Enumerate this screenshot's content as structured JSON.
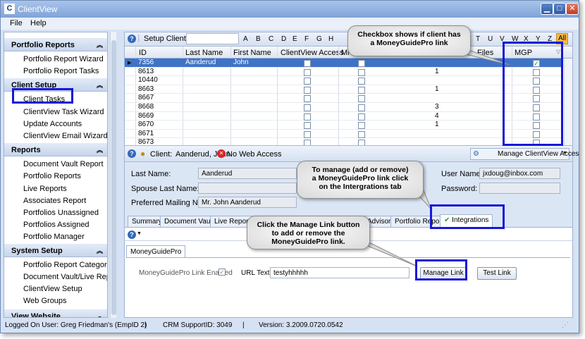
{
  "window": {
    "title": "ClientView"
  },
  "menu": [
    "File",
    "Help"
  ],
  "sidebar": {
    "sections": [
      {
        "title": "Portfolio Reports",
        "items": [
          "Portfolio Report Wizard",
          "Portfolio Report Tasks"
        ]
      },
      {
        "title": "Client Setup",
        "items": [
          "Client Tasks",
          "ClientView Task Wizard",
          "Update Accounts",
          "ClientView Email Wizard"
        ]
      },
      {
        "title": "Reports",
        "items": [
          "Document Vault Report",
          "Portfolio Reports",
          "Live Reports",
          "Associates Report",
          "Portfolios Unassigned",
          "Portfolios Assigned",
          "Portfolio Manager"
        ]
      },
      {
        "title": "System Setup",
        "items": [
          "Portfolio Report Categories..",
          "Document Vault/Live Report..",
          "ClientView Setup",
          "Web Groups"
        ]
      },
      {
        "title": "View Website",
        "items": []
      }
    ]
  },
  "toolbar": {
    "title": "Setup Client",
    "letters": [
      "A",
      "B",
      "C",
      "D",
      "E",
      "F",
      "G",
      "H",
      "T",
      "U",
      "V",
      "W",
      "X",
      "Y",
      "Z"
    ],
    "all_label": "All"
  },
  "grid": {
    "columns": [
      "ID",
      "Last Name",
      "First Name",
      "ClientView Access",
      "Mi",
      "Files",
      "MGP"
    ],
    "rows": [
      {
        "id": "7356",
        "last": "Aanderud",
        "first": "John",
        "files": "",
        "mgp": true
      },
      {
        "id": "8613",
        "last": "",
        "first": "",
        "files": "1",
        "mgp": false
      },
      {
        "id": "10440",
        "last": "",
        "first": "",
        "files": "",
        "mgp": false
      },
      {
        "id": "8663",
        "last": "",
        "first": "",
        "files": "1",
        "mgp": false
      },
      {
        "id": "8667",
        "last": "",
        "first": "",
        "files": "",
        "mgp": false
      },
      {
        "id": "8668",
        "last": "",
        "first": "",
        "files": "3",
        "mgp": false
      },
      {
        "id": "8669",
        "last": "",
        "first": "",
        "files": "4",
        "mgp": false
      },
      {
        "id": "8670",
        "last": "",
        "first": "",
        "files": "1",
        "mgp": false
      },
      {
        "id": "8671",
        "last": "",
        "first": "",
        "files": "",
        "mgp": false
      },
      {
        "id": "8673",
        "last": "",
        "first": "",
        "files": "",
        "mgp": false
      }
    ]
  },
  "infobar": {
    "client_label": "Client:",
    "client_name": "Aanderud, John",
    "web_access": "No Web Access",
    "manage_access": "Manage ClientView Access"
  },
  "details": {
    "last_name_label": "Last Name:",
    "last_name": "Aanderud",
    "spouse_label": "Spouse Last Name:",
    "spouse": "",
    "mailing_label": "Preferred Mailing Name:",
    "mailing": "Mr. John Aanderud",
    "user_label": "User Name:",
    "user": "jxdoug@inbox.com",
    "password_label": "Password:",
    "password": ""
  },
  "tabs": [
    "Summary",
    "Document Vault",
    "Live Reports",
    "Advisor",
    "Portfolio Reports",
    "Integrations"
  ],
  "integrations": {
    "subtab": "MoneyGuidePro",
    "link_enabled_label": "MoneyGuidePro Link Enabled",
    "url_label": "URL Text",
    "url_value": "testyhhhhh",
    "manage_button": "Manage Link",
    "test_button": "Test Link"
  },
  "status": {
    "user": "Logged On User: Greg Friedman's (EmpID 2)",
    "support": "CRM SupportID: 3049",
    "version": "Version: 3.2009.0720.0542"
  },
  "callouts": {
    "mgp": "Checkbox shows if client has\na MoneyGuidePro link",
    "integrations": "To manage (add or remove)\na MoneyGuidePro link click\non the Intergrations tab",
    "manage": "Click the Manage Link button\nto add or remove the\nMoneyGuidePro link."
  },
  "colors": {
    "selected_row": "#3f73c7",
    "highlight": "#1717d6"
  }
}
